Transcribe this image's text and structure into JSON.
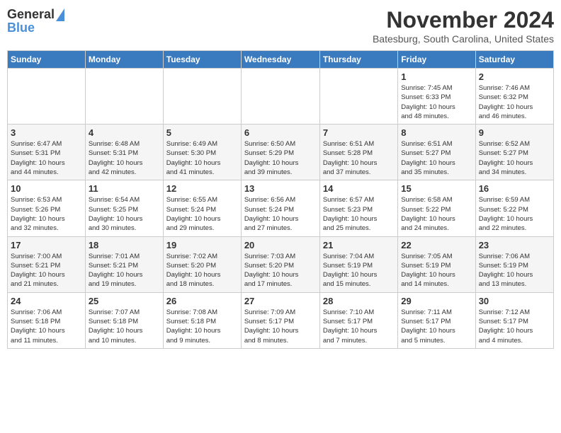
{
  "logo": {
    "general": "General",
    "blue": "Blue"
  },
  "title": "November 2024",
  "location": "Batesburg, South Carolina, United States",
  "days_of_week": [
    "Sunday",
    "Monday",
    "Tuesday",
    "Wednesday",
    "Thursday",
    "Friday",
    "Saturday"
  ],
  "weeks": [
    [
      {
        "day": "",
        "info": ""
      },
      {
        "day": "",
        "info": ""
      },
      {
        "day": "",
        "info": ""
      },
      {
        "day": "",
        "info": ""
      },
      {
        "day": "",
        "info": ""
      },
      {
        "day": "1",
        "info": "Sunrise: 7:45 AM\nSunset: 6:33 PM\nDaylight: 10 hours\nand 48 minutes."
      },
      {
        "day": "2",
        "info": "Sunrise: 7:46 AM\nSunset: 6:32 PM\nDaylight: 10 hours\nand 46 minutes."
      }
    ],
    [
      {
        "day": "3",
        "info": "Sunrise: 6:47 AM\nSunset: 5:31 PM\nDaylight: 10 hours\nand 44 minutes."
      },
      {
        "day": "4",
        "info": "Sunrise: 6:48 AM\nSunset: 5:31 PM\nDaylight: 10 hours\nand 42 minutes."
      },
      {
        "day": "5",
        "info": "Sunrise: 6:49 AM\nSunset: 5:30 PM\nDaylight: 10 hours\nand 41 minutes."
      },
      {
        "day": "6",
        "info": "Sunrise: 6:50 AM\nSunset: 5:29 PM\nDaylight: 10 hours\nand 39 minutes."
      },
      {
        "day": "7",
        "info": "Sunrise: 6:51 AM\nSunset: 5:28 PM\nDaylight: 10 hours\nand 37 minutes."
      },
      {
        "day": "8",
        "info": "Sunrise: 6:51 AM\nSunset: 5:27 PM\nDaylight: 10 hours\nand 35 minutes."
      },
      {
        "day": "9",
        "info": "Sunrise: 6:52 AM\nSunset: 5:27 PM\nDaylight: 10 hours\nand 34 minutes."
      }
    ],
    [
      {
        "day": "10",
        "info": "Sunrise: 6:53 AM\nSunset: 5:26 PM\nDaylight: 10 hours\nand 32 minutes."
      },
      {
        "day": "11",
        "info": "Sunrise: 6:54 AM\nSunset: 5:25 PM\nDaylight: 10 hours\nand 30 minutes."
      },
      {
        "day": "12",
        "info": "Sunrise: 6:55 AM\nSunset: 5:24 PM\nDaylight: 10 hours\nand 29 minutes."
      },
      {
        "day": "13",
        "info": "Sunrise: 6:56 AM\nSunset: 5:24 PM\nDaylight: 10 hours\nand 27 minutes."
      },
      {
        "day": "14",
        "info": "Sunrise: 6:57 AM\nSunset: 5:23 PM\nDaylight: 10 hours\nand 25 minutes."
      },
      {
        "day": "15",
        "info": "Sunrise: 6:58 AM\nSunset: 5:22 PM\nDaylight: 10 hours\nand 24 minutes."
      },
      {
        "day": "16",
        "info": "Sunrise: 6:59 AM\nSunset: 5:22 PM\nDaylight: 10 hours\nand 22 minutes."
      }
    ],
    [
      {
        "day": "17",
        "info": "Sunrise: 7:00 AM\nSunset: 5:21 PM\nDaylight: 10 hours\nand 21 minutes."
      },
      {
        "day": "18",
        "info": "Sunrise: 7:01 AM\nSunset: 5:21 PM\nDaylight: 10 hours\nand 19 minutes."
      },
      {
        "day": "19",
        "info": "Sunrise: 7:02 AM\nSunset: 5:20 PM\nDaylight: 10 hours\nand 18 minutes."
      },
      {
        "day": "20",
        "info": "Sunrise: 7:03 AM\nSunset: 5:20 PM\nDaylight: 10 hours\nand 17 minutes."
      },
      {
        "day": "21",
        "info": "Sunrise: 7:04 AM\nSunset: 5:19 PM\nDaylight: 10 hours\nand 15 minutes."
      },
      {
        "day": "22",
        "info": "Sunrise: 7:05 AM\nSunset: 5:19 PM\nDaylight: 10 hours\nand 14 minutes."
      },
      {
        "day": "23",
        "info": "Sunrise: 7:06 AM\nSunset: 5:19 PM\nDaylight: 10 hours\nand 13 minutes."
      }
    ],
    [
      {
        "day": "24",
        "info": "Sunrise: 7:06 AM\nSunset: 5:18 PM\nDaylight: 10 hours\nand 11 minutes."
      },
      {
        "day": "25",
        "info": "Sunrise: 7:07 AM\nSunset: 5:18 PM\nDaylight: 10 hours\nand 10 minutes."
      },
      {
        "day": "26",
        "info": "Sunrise: 7:08 AM\nSunset: 5:18 PM\nDaylight: 10 hours\nand 9 minutes."
      },
      {
        "day": "27",
        "info": "Sunrise: 7:09 AM\nSunset: 5:17 PM\nDaylight: 10 hours\nand 8 minutes."
      },
      {
        "day": "28",
        "info": "Sunrise: 7:10 AM\nSunset: 5:17 PM\nDaylight: 10 hours\nand 7 minutes."
      },
      {
        "day": "29",
        "info": "Sunrise: 7:11 AM\nSunset: 5:17 PM\nDaylight: 10 hours\nand 5 minutes."
      },
      {
        "day": "30",
        "info": "Sunrise: 7:12 AM\nSunset: 5:17 PM\nDaylight: 10 hours\nand 4 minutes."
      }
    ]
  ]
}
